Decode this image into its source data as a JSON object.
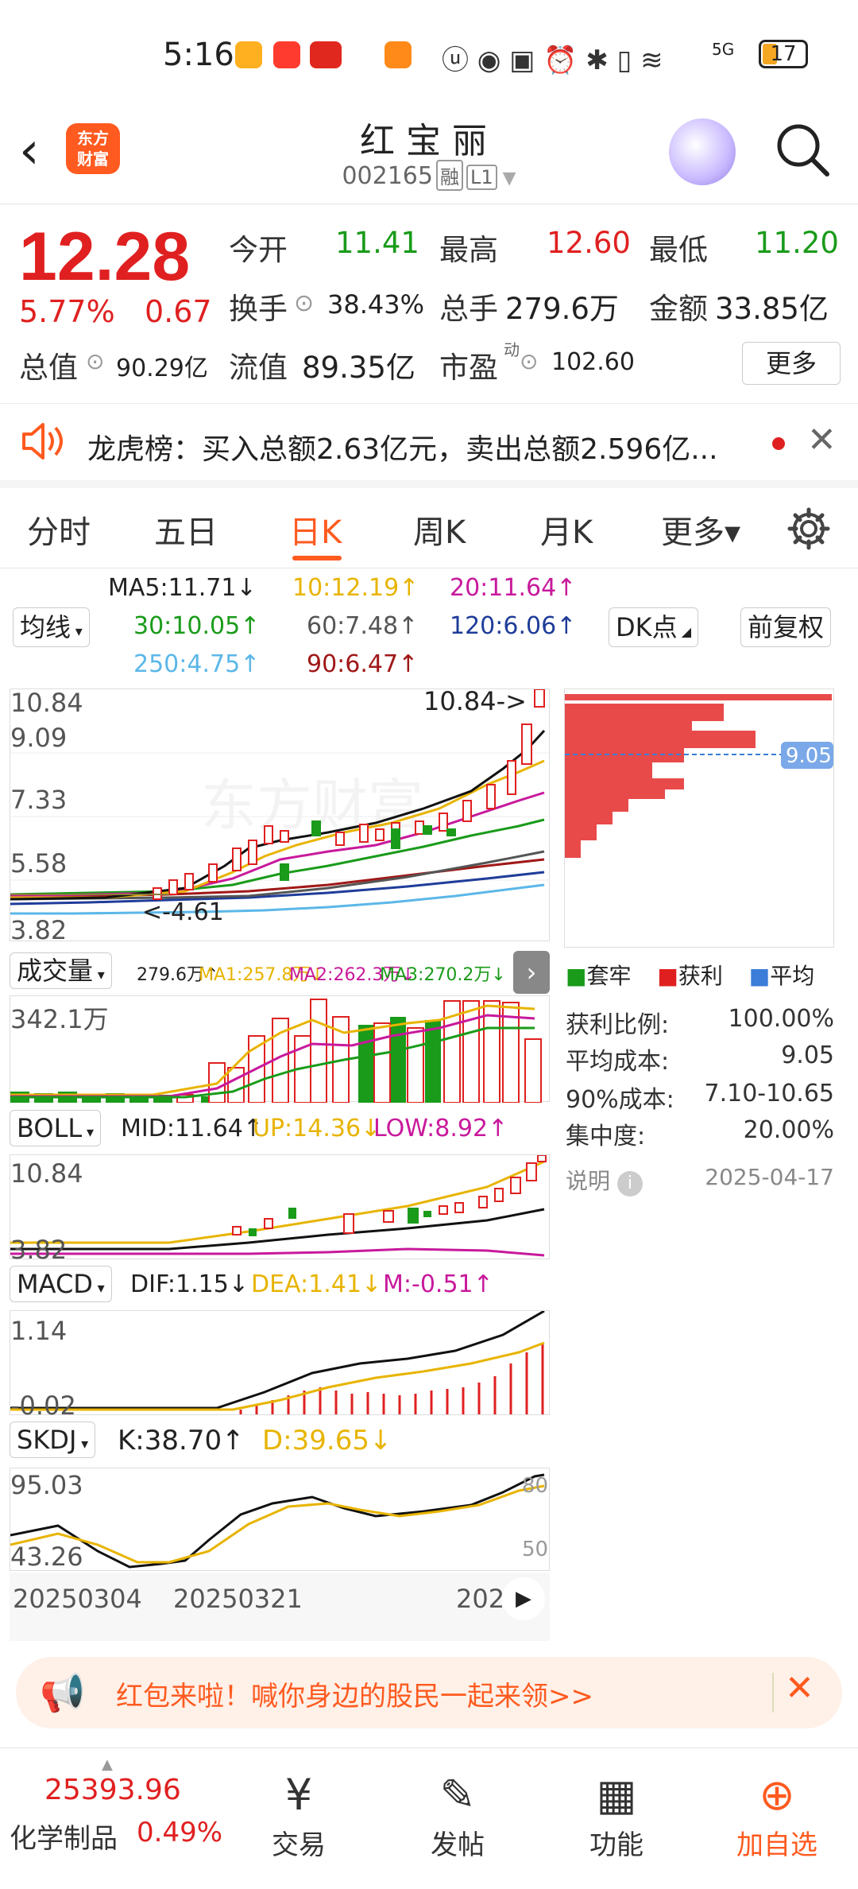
{
  "status": {
    "time": "5:16",
    "network": "5G",
    "battery": "17"
  },
  "header": {
    "back": "‹",
    "logo": "东方\n财富",
    "name": "红宝丽",
    "code": "002165",
    "tag1": "融",
    "tag2": "L1"
  },
  "quote": {
    "price": "12.28",
    "pct": "5.77%",
    "chg": "0.67",
    "open_label": "今开",
    "open": "11.41",
    "high_label": "最高",
    "high": "12.60",
    "low_label": "最低",
    "low": "11.20",
    "turnover_label": "换手",
    "turnover": "38.43%",
    "vol_label": "总手",
    "vol": "279.6万",
    "amt_label": "金额",
    "amt": "33.85亿",
    "mktcap_label": "总值",
    "mktcap": "90.29亿",
    "float_label": "流值",
    "float": "89.35亿",
    "pe_label": "市盈",
    "pe_sup": "动",
    "pe": "102.60",
    "more": "更多"
  },
  "notice": {
    "text": "龙虎榜：买入总额2.63亿元，卖出总额2.596亿..."
  },
  "tabs": [
    "分时",
    "五日",
    "日K",
    "周K",
    "月K",
    "更多▾"
  ],
  "ma": {
    "selector": "均线",
    "ma5": "MA5:11.71↓",
    "ma10": "10:12.19↑",
    "ma20": "20:11.64↑",
    "ma30": "30:10.05↑",
    "ma60": "60:7.48↑",
    "ma120": "120:6.06↑",
    "ma250": "250:4.75↑",
    "ma90": "90:6.47↑",
    "dk": "DK点",
    "fq": "前复权"
  },
  "kline": {
    "y_top": "10.84",
    "y2": "9.09",
    "y3": "7.33",
    "y4": "5.58",
    "y_bot": "3.82",
    "max_note": "10.84->",
    "min_note": "<-4.61"
  },
  "chip": {
    "cost_tag": "9.05",
    "legend": [
      "套牢",
      "获利",
      "平均"
    ],
    "rows": [
      [
        "获利比例:",
        "100.00%"
      ],
      [
        "平均成本:",
        "9.05"
      ],
      [
        "90%成本:",
        "7.10-10.65"
      ],
      [
        "集中度:",
        "20.00%"
      ]
    ],
    "note": "说明",
    "date": "2025-04-17"
  },
  "volume": {
    "selector": "成交量",
    "v": "279.6万↑",
    "ma1": "MA1:257.8万↓",
    "ma2": "MA2:262.3万↓",
    "ma3": "MA3:270.2万↓",
    "ymax": "342.1万"
  },
  "boll": {
    "selector": "BOLL",
    "mid": "MID:11.64↑",
    "up": "UP:14.36↓",
    "low": "LOW:8.92↑",
    "ytop": "10.84",
    "ybot": "3.82"
  },
  "macd": {
    "selector": "MACD",
    "dif": "DIF:1.15↓",
    "dea": "DEA:1.41↓",
    "m": "M:-0.51↑",
    "ytop": "1.14",
    "ybot": "-0.02"
  },
  "skdj": {
    "selector": "SKDJ",
    "k": "K:38.70↑",
    "d": "D:39.65↓",
    "ytop": "95.03",
    "ybot": "43.26",
    "r80": "80",
    "r50": "50"
  },
  "dates": [
    "20250304",
    "20250321",
    "202"
  ],
  "banner": {
    "text": "红包来啦！喊你身边的股民一起来领>>"
  },
  "bottom": {
    "index_value": "25393.96",
    "index_name": "化学制品",
    "index_pct": "0.49%",
    "nav": [
      {
        "icon": "¥",
        "label": "交易"
      },
      {
        "icon": "✎",
        "label": "发帖"
      },
      {
        "icon": "▦",
        "label": "功能"
      },
      {
        "icon": "⊕",
        "label": "加自选"
      }
    ]
  },
  "colors": {
    "red": "#e02020",
    "green": "#1a9b1a",
    "accent": "#ff5a1f",
    "ma10": "#e8b400",
    "ma20": "#c8199c",
    "ma30": "#1a9b1a",
    "ma60": "#555555",
    "ma120": "#1f3c99",
    "ma250": "#5bb7e8",
    "ma90": "#a01818"
  }
}
